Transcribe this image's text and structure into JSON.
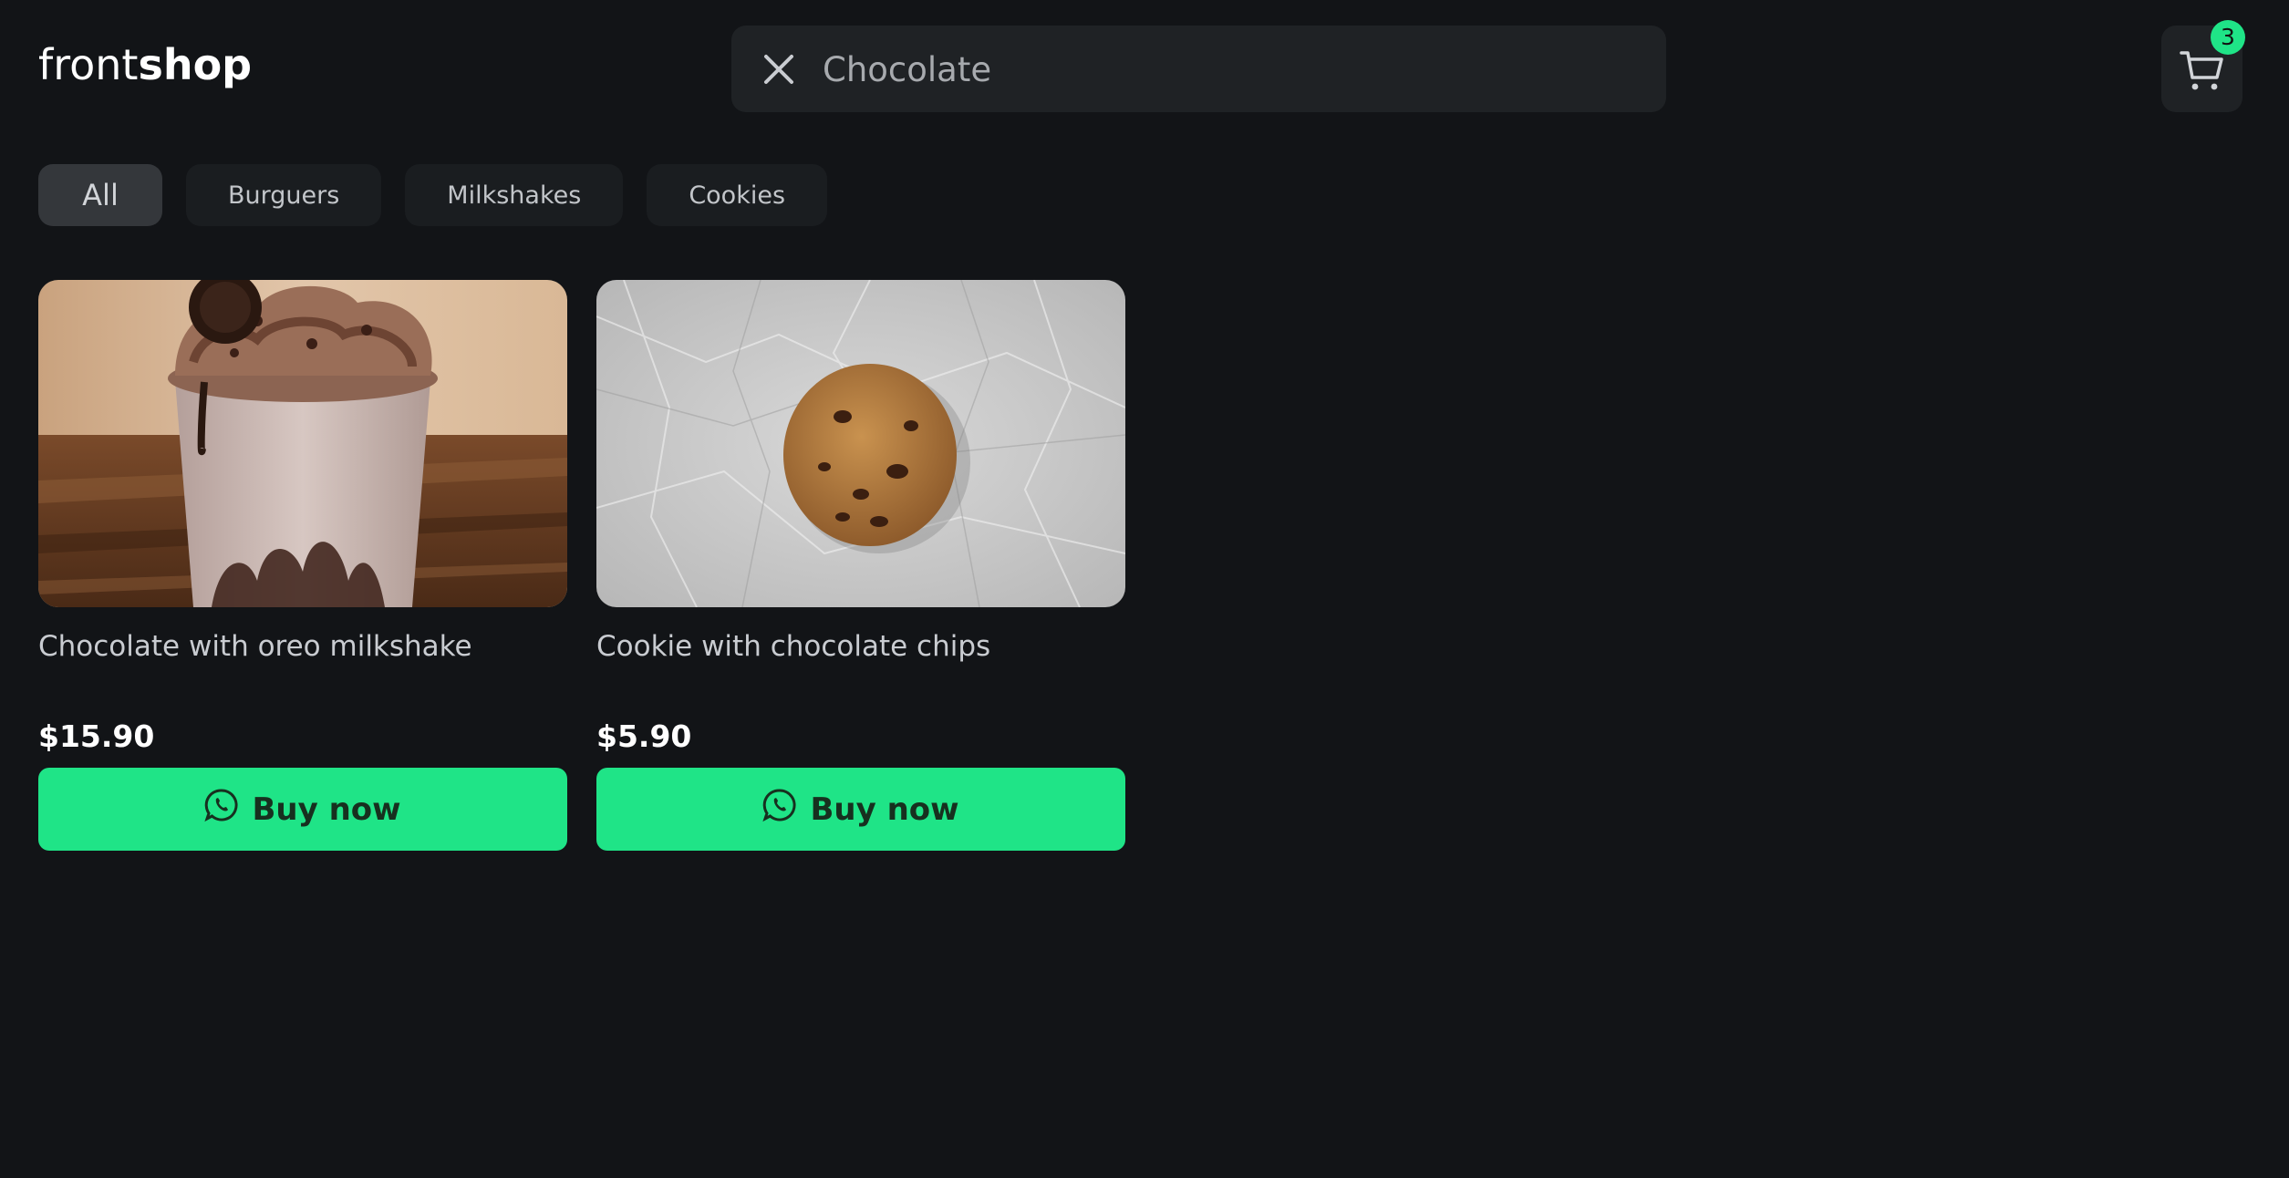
{
  "brand": {
    "light": "front",
    "bold": "shop"
  },
  "search": {
    "value": "Chocolate",
    "placeholder": ""
  },
  "cart": {
    "count": "3"
  },
  "filters": [
    {
      "label": "All",
      "active": true
    },
    {
      "label": "Burguers",
      "active": false
    },
    {
      "label": "Milkshakes",
      "active": false
    },
    {
      "label": "Cookies",
      "active": false
    }
  ],
  "products": [
    {
      "title": "Chocolate with oreo milkshake",
      "price": "$15.90",
      "button": "Buy now",
      "image": "milkshake"
    },
    {
      "title": "Cookie with chocolate chips",
      "price": "$5.90",
      "button": "Buy now",
      "image": "cookie"
    }
  ],
  "colors": {
    "background": "#121417",
    "surface": "#1f2225",
    "accent": "#1fe487",
    "chip": "#1a1d20",
    "chip_active": "#34373b"
  },
  "icons": {
    "clear": "close-icon",
    "cart": "cart-icon",
    "buy": "whatsapp-icon"
  }
}
